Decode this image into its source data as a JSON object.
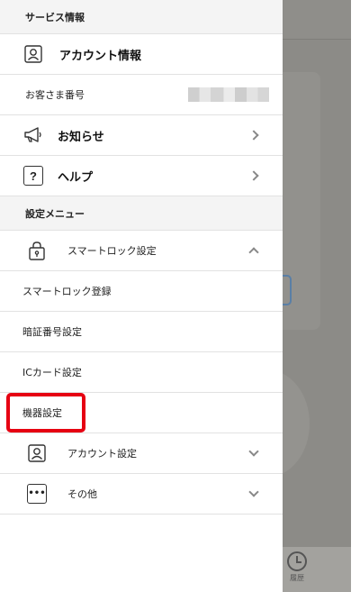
{
  "drawer": {
    "service_section": "サービス情報",
    "account_info": {
      "label": "アカウント情報",
      "icon": "user-icon"
    },
    "customer_number": {
      "label": "お客さま番号"
    },
    "news": {
      "label": "お知らせ",
      "icon": "megaphone-icon"
    },
    "help": {
      "label": "ヘルプ",
      "icon": "question-icon",
      "glyph": "?"
    },
    "settings_section": "設定メニュー",
    "smartlock_settings": {
      "label": "スマートロック設定",
      "icon": "lock-icon"
    },
    "smartlock_register": "スマートロック登録",
    "pin_settings": "暗証番号設定",
    "ic_card_settings": "ICカード設定",
    "device_settings": "機器設定",
    "account_settings": {
      "label": "アカウント設定",
      "icon": "user-icon"
    },
    "other": {
      "label": "その他",
      "icon": "more-icon",
      "glyph": "•••"
    }
  },
  "background": {
    "history_label": "履歴"
  },
  "colors": {
    "highlight": "#e60012",
    "overlay": "#8c8b87"
  }
}
